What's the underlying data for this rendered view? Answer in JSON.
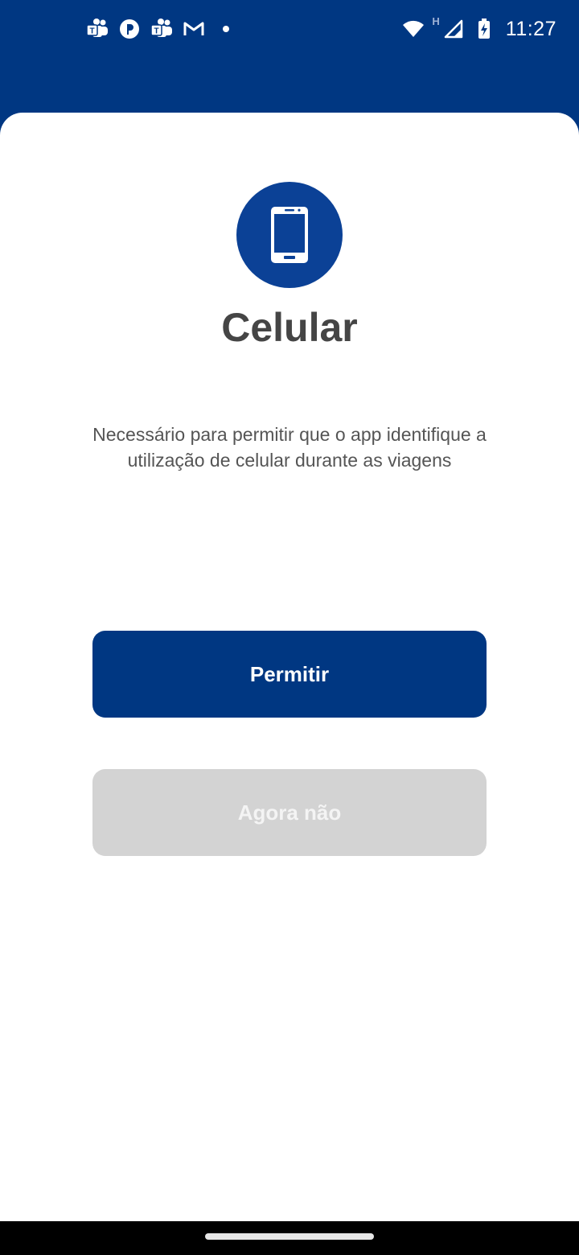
{
  "status_bar": {
    "time": "11:27",
    "network_type": "H",
    "notification_icons": [
      "teams-icon",
      "app-p-icon",
      "teams-icon",
      "gmail-icon",
      "dot-icon"
    ],
    "system_icons": [
      "wifi-icon",
      "signal-icon",
      "battery-charging-icon"
    ]
  },
  "permission": {
    "icon": "smartphone-icon",
    "title": "Celular",
    "description": "Necessário para permitir que o app identifique a utilização de celular durante as viagens",
    "allow_label": "Permitir",
    "deny_label": "Agora não"
  },
  "colors": {
    "primary": "#003782",
    "icon_circle": "#0b4196",
    "disabled_button": "#d3d3d3"
  }
}
